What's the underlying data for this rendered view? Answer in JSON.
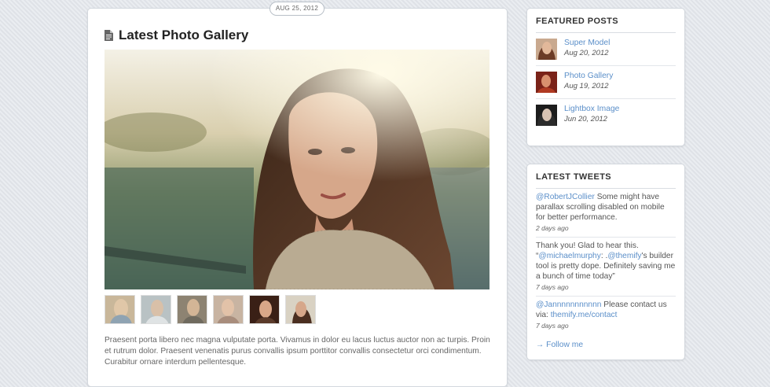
{
  "post": {
    "date": "AUG 25, 2012",
    "title": "Latest Photo Gallery",
    "body": "Praesent porta libero nec magna vulputate porta. Vivamus in dolor eu lacus luctus auctor non ac turpis. Proin et rutrum dolor. Praesent venenatis purus convallis ipsum porttitor convallis consectetur orci condimentum. Curabitur ornare interdum pellentesque."
  },
  "featured": {
    "heading": "FEATURED POSTS",
    "items": [
      {
        "title": "Super Model",
        "date": "Aug 20, 2012"
      },
      {
        "title": "Photo Gallery",
        "date": "Aug 19, 2012"
      },
      {
        "title": "Lightbox Image",
        "date": "Jun 20, 2012"
      }
    ]
  },
  "tweets": {
    "heading": "LATEST TWEETS",
    "items": [
      {
        "handle": "@RobertJCollier",
        "text": " Some might have parallax scrolling disabled on mobile for better performance.",
        "time": "2 days ago"
      },
      {
        "pre": "Thank you! Glad to hear this. “",
        "handle": "@michaelmurphy",
        "mid": ": .",
        "handle2": "@themify",
        "text": "'s builder tool is pretty dope. Definitely saving me a bunch of time today”",
        "time": "7 days ago"
      },
      {
        "handle": "@Jannnnnnnnnnn",
        "text": " Please contact us via: ",
        "link": "themify.me/contact",
        "time": "7 days ago"
      }
    ],
    "follow": "→ Follow me"
  },
  "colors": {
    "link": "#5b8fc9",
    "background": "#e3e7ec"
  }
}
